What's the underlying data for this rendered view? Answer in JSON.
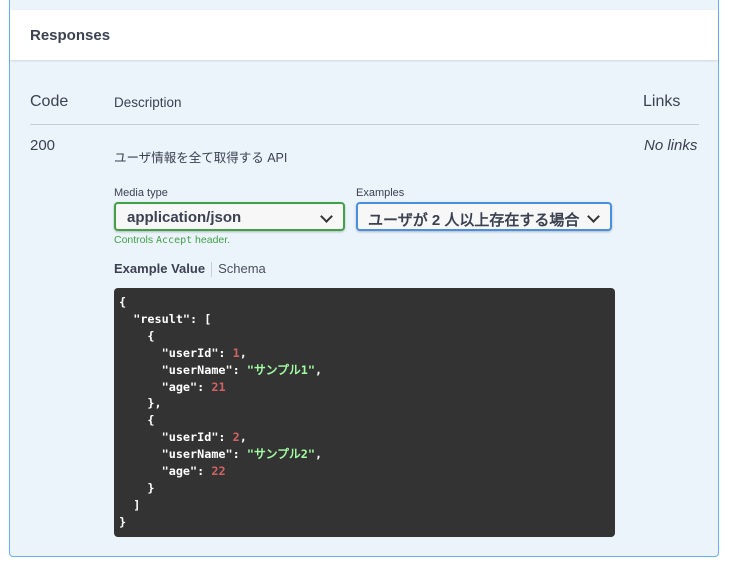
{
  "responses": {
    "title": "Responses",
    "headers": {
      "code": "Code",
      "description": "Description",
      "links": "Links"
    },
    "row": {
      "code": "200",
      "description": "ユーザ情報を全て取得する API",
      "links": "No links",
      "media_type_label": "Media type",
      "media_type_value": "application/json",
      "examples_label": "Examples",
      "examples_value": "ユーザが 2 人以上存在する場合",
      "controls_prefix": "Controls ",
      "controls_code": "Accept",
      "controls_suffix": " header.",
      "tab_example_value": "Example Value",
      "tab_schema": "Schema",
      "example_json": {
        "key_result": "\"result\"",
        "items": [
          {
            "userId": "1",
            "userName": "\"サンプル1\"",
            "age": "21"
          },
          {
            "userId": "2",
            "userName": "\"サンプル2\"",
            "age": "22"
          }
        ]
      }
    }
  },
  "colors": {
    "accent_border": "#61affe",
    "media_select_border": "#41a146",
    "examples_select_border": "#4990e2",
    "code_bg": "#333333",
    "number": "#d36363",
    "string": "#a2fca2"
  },
  "icons": {
    "select_chevron": "chevron-down-icon"
  }
}
